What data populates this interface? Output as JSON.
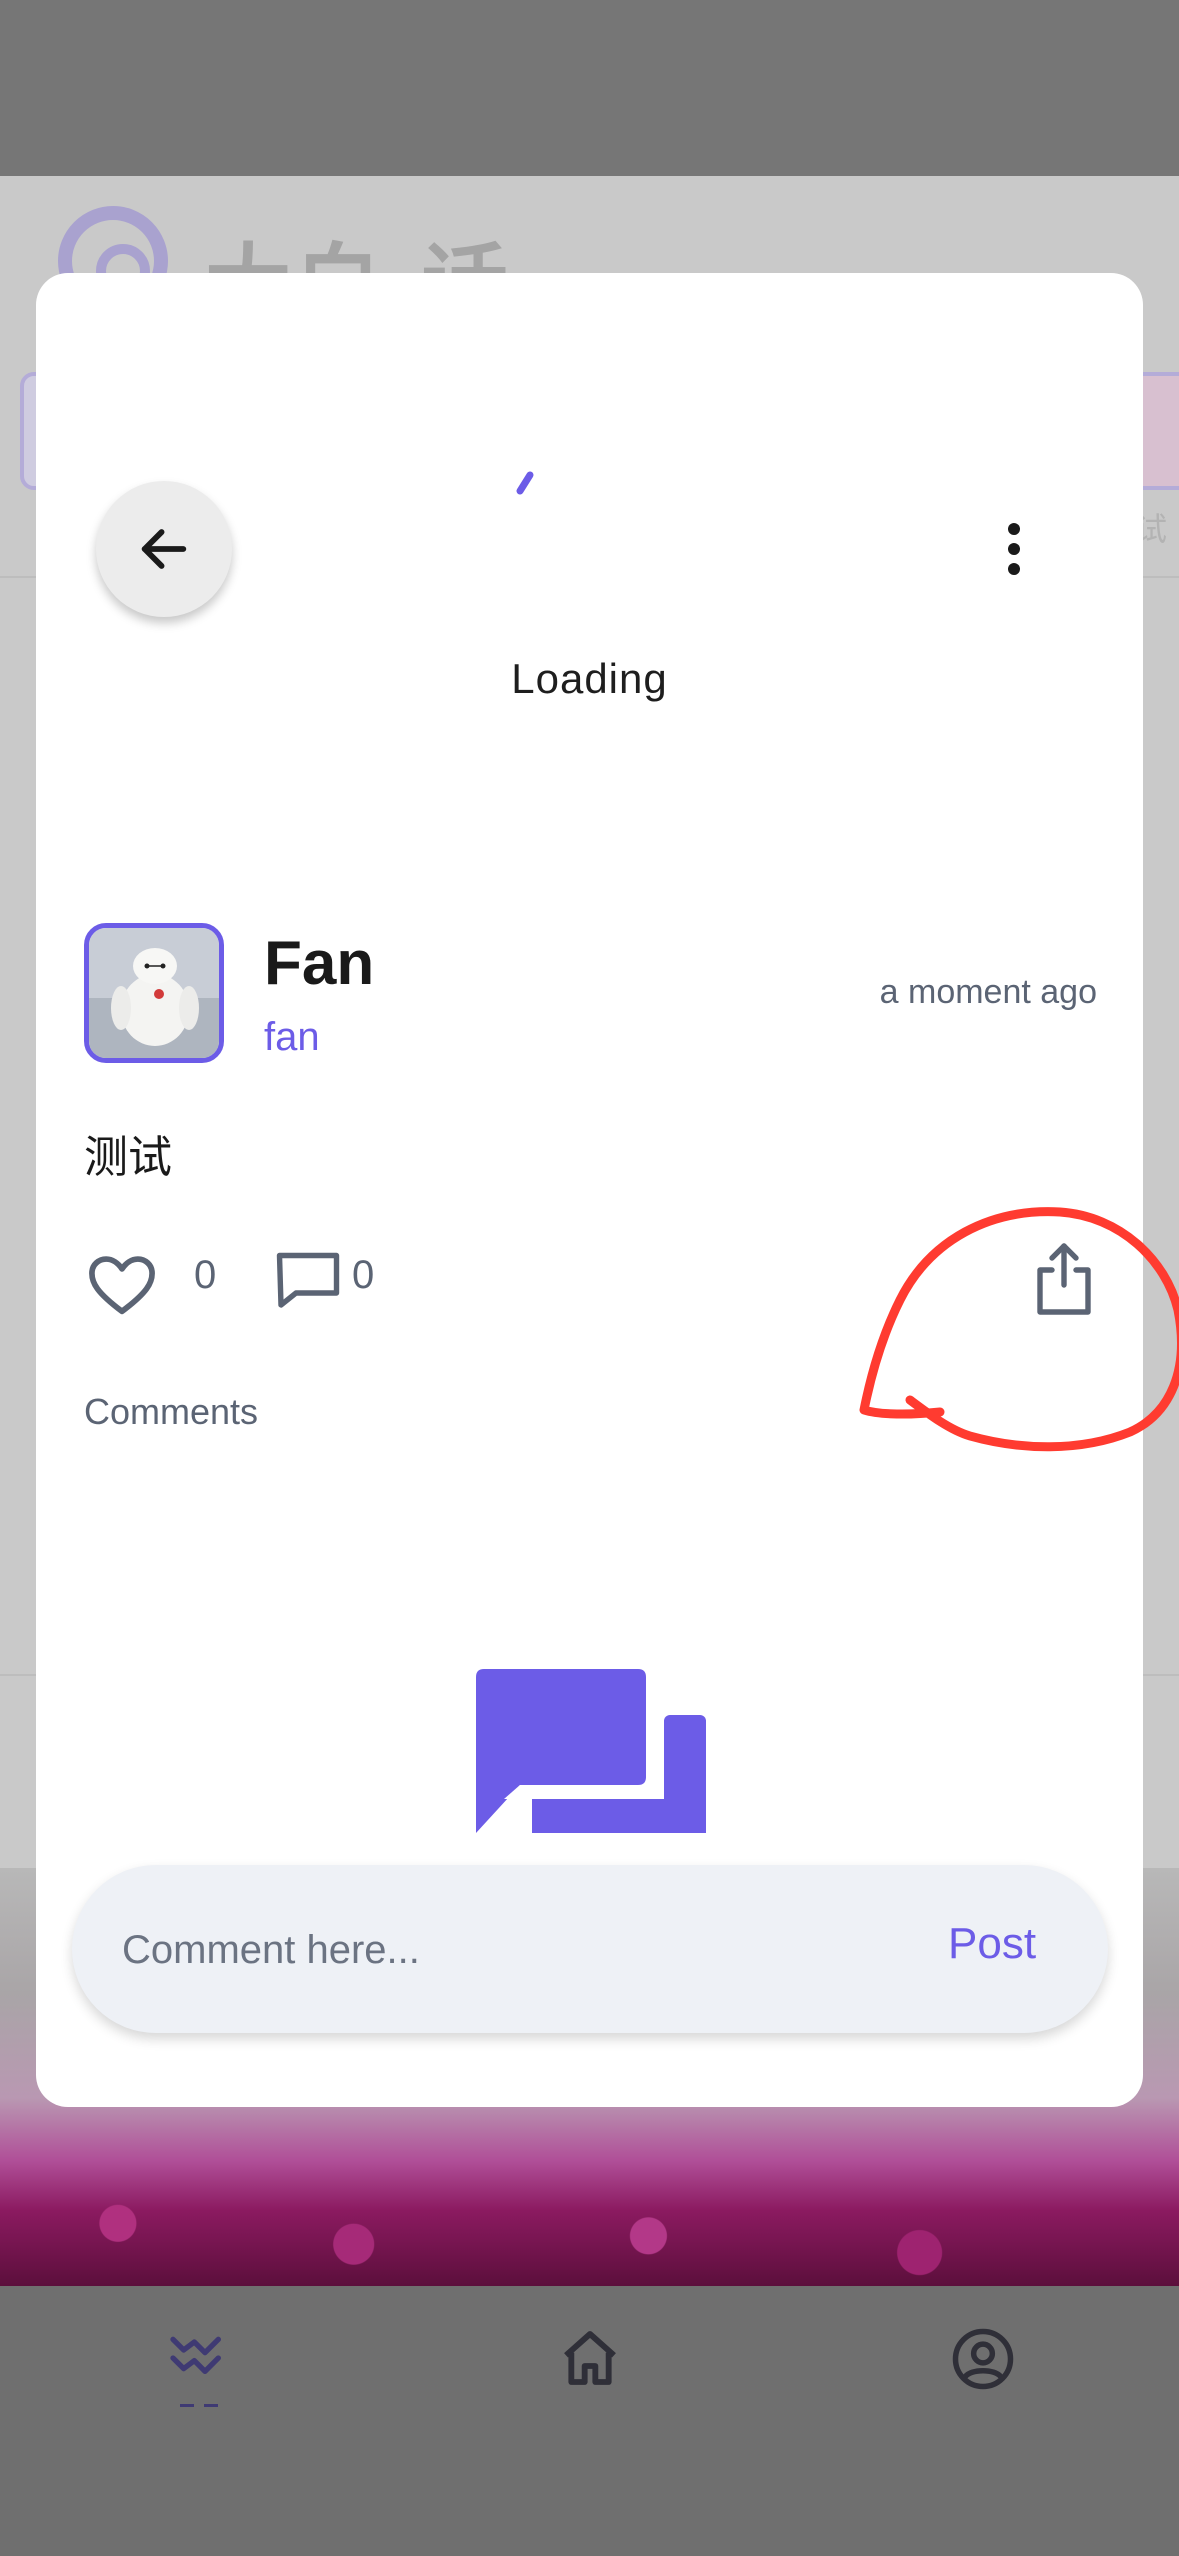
{
  "background_app": {
    "title": "大白·话",
    "side_label": "试"
  },
  "modal": {
    "loading_text": "Loading",
    "post": {
      "author_name": "Fan",
      "author_handle": "fan",
      "timestamp": "a moment ago",
      "content": "测试",
      "like_count": "0",
      "comment_count": "0"
    },
    "comments_title": "Comments",
    "comment_input": {
      "placeholder": "Comment here...",
      "value": ""
    },
    "post_button_label": "Post"
  },
  "icons": {
    "back": "arrow-left-icon",
    "more": "more-vertical-icon",
    "like": "heart-icon",
    "comment": "comment-icon",
    "share": "share-icon",
    "empty_comments": "chat-bubbles-icon",
    "nav_feed": "activity-icon",
    "nav_home": "home-icon",
    "nav_profile": "user-circle-icon"
  },
  "colors": {
    "accent": "#6c5ce7",
    "annotation": "#ff3b30",
    "muted_text": "#5b6474",
    "scrim": "#7a7a7a"
  }
}
